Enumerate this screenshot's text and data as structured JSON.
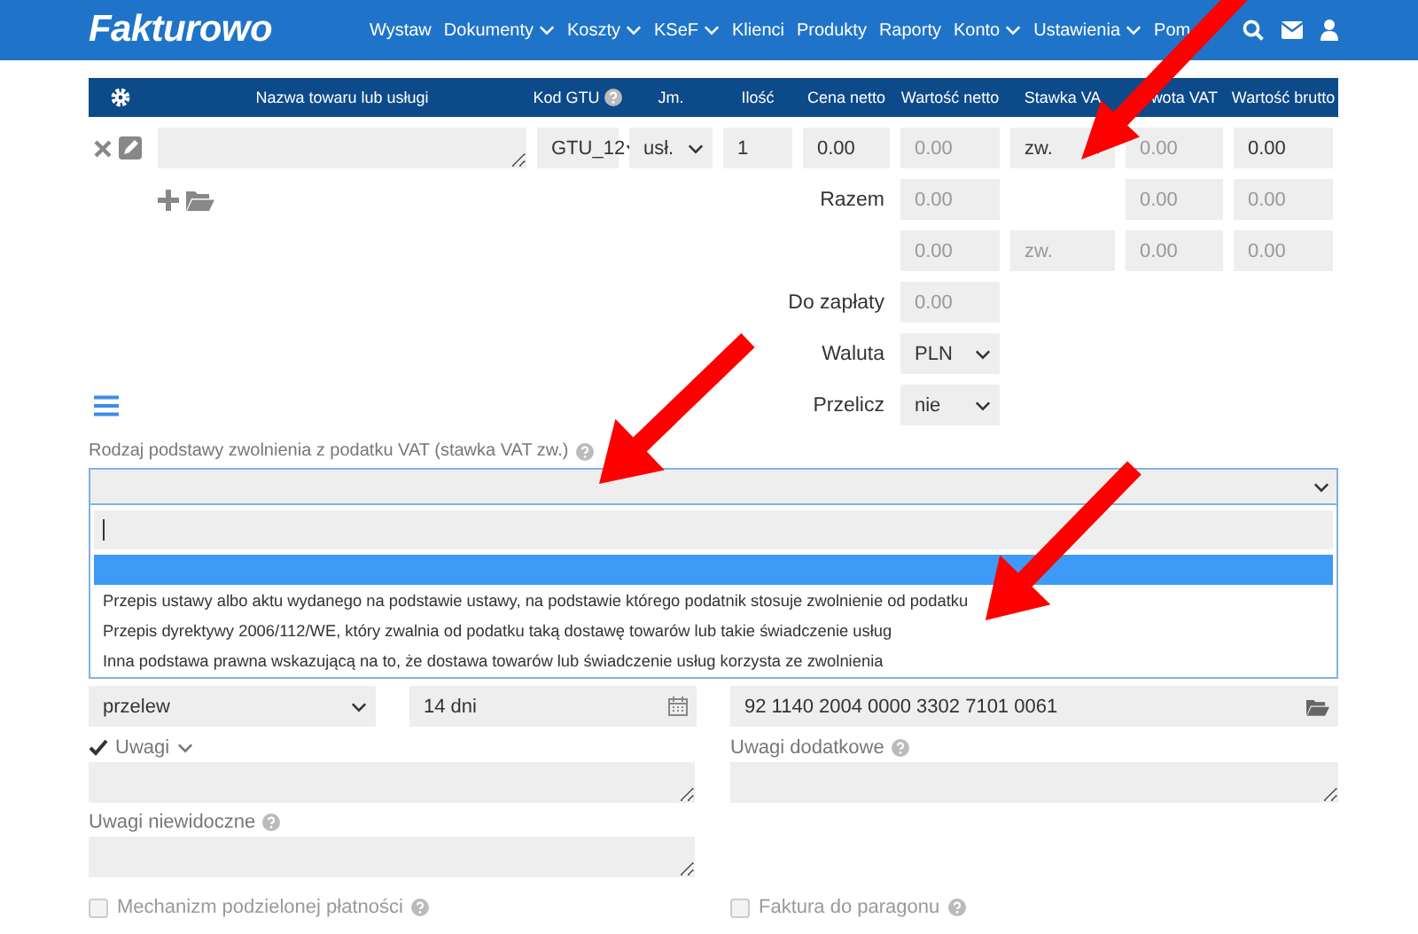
{
  "header": {
    "logo": "Fakturowo",
    "nav": [
      {
        "label": "Wystaw",
        "dropdown": false
      },
      {
        "label": "Dokumenty",
        "dropdown": true
      },
      {
        "label": "Koszty",
        "dropdown": true
      },
      {
        "label": "KSeF",
        "dropdown": true
      },
      {
        "label": "Klienci",
        "dropdown": false
      },
      {
        "label": "Produkty",
        "dropdown": false
      },
      {
        "label": "Raporty",
        "dropdown": false
      },
      {
        "label": "Konto",
        "dropdown": true
      },
      {
        "label": "Ustawienia",
        "dropdown": true
      },
      {
        "label": "Pom",
        "dropdown": false
      }
    ]
  },
  "table": {
    "columns": [
      {
        "label": "Nazwa towaru lub usługi",
        "help": false
      },
      {
        "label": "Kod GTU",
        "help": true
      },
      {
        "label": "Jm.",
        "help": false
      },
      {
        "label": "Ilość",
        "help": false
      },
      {
        "label": "Cena netto",
        "help": false
      },
      {
        "label": "Wartość netto",
        "help": false
      },
      {
        "label": "Stawka VA",
        "help": false
      },
      {
        "label": "wota VAT",
        "help": false
      },
      {
        "label": "Wartość brutto",
        "help": false
      }
    ],
    "rows": [
      {
        "gtu": "GTU_12",
        "unit": "usł.",
        "quantity": "1",
        "net_price": "0.00",
        "net_value": "0.00",
        "vat_rate": "zw.",
        "vat_amount": "0.00",
        "gross_value": "0.00"
      }
    ],
    "total": {
      "label": "Razem",
      "net_value": "0.00",
      "vat_amount": "0.00",
      "gross_value": "0.00"
    },
    "rate_summary": [
      {
        "net_value": "0.00",
        "vat_rate": "zw.",
        "vat_amount": "0.00",
        "gross_value": "0.00"
      }
    ]
  },
  "amount_due": {
    "label": "Do zapłaty",
    "value": "0.00"
  },
  "currency": {
    "label": "Waluta",
    "value": "PLN"
  },
  "convert": {
    "label": "Przelicz",
    "value": "nie"
  },
  "exemption": {
    "label": "Rodzaj podstawy zwolnienia z podatku VAT (stawka VAT zw.)",
    "help": true,
    "options": [
      {
        "selected": true
      },
      {
        "label": "Przepis ustawy albo aktu wydanego na podstawie ustawy, na podstawie którego podatnik stosuje zwolnienie od podatku",
        "selected": false
      },
      {
        "label": "Przepis dyrektywy 2006/112/WE, który zwalnia od podatku taką dostawę towarów lub takie świadczenie usług",
        "selected": false
      },
      {
        "label": "Inna podstawa prawna wskazującą na to, że dostawa towarów lub świadczenie usług korzysta ze zwolnienia",
        "selected": false
      }
    ]
  },
  "payment": [
    {
      "kind": "select",
      "value": "przelew"
    },
    {
      "kind": "date",
      "value": "14 dni"
    },
    {
      "kind": "account",
      "value": "92 1140 2004 0000 3302 7101 0061"
    }
  ],
  "notes": {
    "label": "Uwagi",
    "checked": true
  },
  "extra_notes": {
    "label": "Uwagi dodatkowe",
    "help": true
  },
  "hidden_notes": {
    "label": "Uwagi niewidoczne",
    "help": true
  },
  "options": [
    {
      "label": "Mechanizm podzielonej płatności",
      "checked": false,
      "help": true
    },
    {
      "label": "Faktura do paragonu",
      "checked": false,
      "help": true
    }
  ]
}
